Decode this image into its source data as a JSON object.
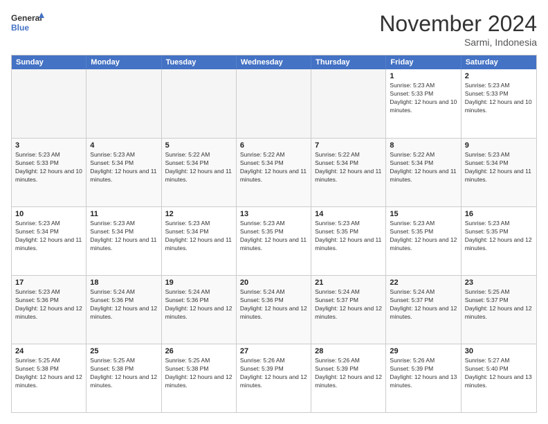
{
  "logo": {
    "line1": "General",
    "line2": "Blue"
  },
  "title": "November 2024",
  "subtitle": "Sarmi, Indonesia",
  "header_days": [
    "Sunday",
    "Monday",
    "Tuesday",
    "Wednesday",
    "Thursday",
    "Friday",
    "Saturday"
  ],
  "rows": [
    [
      {
        "day": "",
        "empty": true
      },
      {
        "day": "",
        "empty": true
      },
      {
        "day": "",
        "empty": true
      },
      {
        "day": "",
        "empty": true
      },
      {
        "day": "",
        "empty": true
      },
      {
        "day": "1",
        "sunrise": "5:23 AM",
        "sunset": "5:33 PM",
        "daylight": "12 hours and 10 minutes."
      },
      {
        "day": "2",
        "sunrise": "5:23 AM",
        "sunset": "5:33 PM",
        "daylight": "12 hours and 10 minutes."
      }
    ],
    [
      {
        "day": "3",
        "sunrise": "5:23 AM",
        "sunset": "5:33 PM",
        "daylight": "12 hours and 10 minutes."
      },
      {
        "day": "4",
        "sunrise": "5:23 AM",
        "sunset": "5:34 PM",
        "daylight": "12 hours and 11 minutes."
      },
      {
        "day": "5",
        "sunrise": "5:22 AM",
        "sunset": "5:34 PM",
        "daylight": "12 hours and 11 minutes."
      },
      {
        "day": "6",
        "sunrise": "5:22 AM",
        "sunset": "5:34 PM",
        "daylight": "12 hours and 11 minutes."
      },
      {
        "day": "7",
        "sunrise": "5:22 AM",
        "sunset": "5:34 PM",
        "daylight": "12 hours and 11 minutes."
      },
      {
        "day": "8",
        "sunrise": "5:22 AM",
        "sunset": "5:34 PM",
        "daylight": "12 hours and 11 minutes."
      },
      {
        "day": "9",
        "sunrise": "5:23 AM",
        "sunset": "5:34 PM",
        "daylight": "12 hours and 11 minutes."
      }
    ],
    [
      {
        "day": "10",
        "sunrise": "5:23 AM",
        "sunset": "5:34 PM",
        "daylight": "12 hours and 11 minutes."
      },
      {
        "day": "11",
        "sunrise": "5:23 AM",
        "sunset": "5:34 PM",
        "daylight": "12 hours and 11 minutes."
      },
      {
        "day": "12",
        "sunrise": "5:23 AM",
        "sunset": "5:34 PM",
        "daylight": "12 hours and 11 minutes."
      },
      {
        "day": "13",
        "sunrise": "5:23 AM",
        "sunset": "5:35 PM",
        "daylight": "12 hours and 11 minutes."
      },
      {
        "day": "14",
        "sunrise": "5:23 AM",
        "sunset": "5:35 PM",
        "daylight": "12 hours and 11 minutes."
      },
      {
        "day": "15",
        "sunrise": "5:23 AM",
        "sunset": "5:35 PM",
        "daylight": "12 hours and 12 minutes."
      },
      {
        "day": "16",
        "sunrise": "5:23 AM",
        "sunset": "5:35 PM",
        "daylight": "12 hours and 12 minutes."
      }
    ],
    [
      {
        "day": "17",
        "sunrise": "5:23 AM",
        "sunset": "5:36 PM",
        "daylight": "12 hours and 12 minutes."
      },
      {
        "day": "18",
        "sunrise": "5:24 AM",
        "sunset": "5:36 PM",
        "daylight": "12 hours and 12 minutes."
      },
      {
        "day": "19",
        "sunrise": "5:24 AM",
        "sunset": "5:36 PM",
        "daylight": "12 hours and 12 minutes."
      },
      {
        "day": "20",
        "sunrise": "5:24 AM",
        "sunset": "5:36 PM",
        "daylight": "12 hours and 12 minutes."
      },
      {
        "day": "21",
        "sunrise": "5:24 AM",
        "sunset": "5:37 PM",
        "daylight": "12 hours and 12 minutes."
      },
      {
        "day": "22",
        "sunrise": "5:24 AM",
        "sunset": "5:37 PM",
        "daylight": "12 hours and 12 minutes."
      },
      {
        "day": "23",
        "sunrise": "5:25 AM",
        "sunset": "5:37 PM",
        "daylight": "12 hours and 12 minutes."
      }
    ],
    [
      {
        "day": "24",
        "sunrise": "5:25 AM",
        "sunset": "5:38 PM",
        "daylight": "12 hours and 12 minutes."
      },
      {
        "day": "25",
        "sunrise": "5:25 AM",
        "sunset": "5:38 PM",
        "daylight": "12 hours and 12 minutes."
      },
      {
        "day": "26",
        "sunrise": "5:25 AM",
        "sunset": "5:38 PM",
        "daylight": "12 hours and 12 minutes."
      },
      {
        "day": "27",
        "sunrise": "5:26 AM",
        "sunset": "5:39 PM",
        "daylight": "12 hours and 12 minutes."
      },
      {
        "day": "28",
        "sunrise": "5:26 AM",
        "sunset": "5:39 PM",
        "daylight": "12 hours and 12 minutes."
      },
      {
        "day": "29",
        "sunrise": "5:26 AM",
        "sunset": "5:39 PM",
        "daylight": "12 hours and 13 minutes."
      },
      {
        "day": "30",
        "sunrise": "5:27 AM",
        "sunset": "5:40 PM",
        "daylight": "12 hours and 13 minutes."
      }
    ]
  ]
}
